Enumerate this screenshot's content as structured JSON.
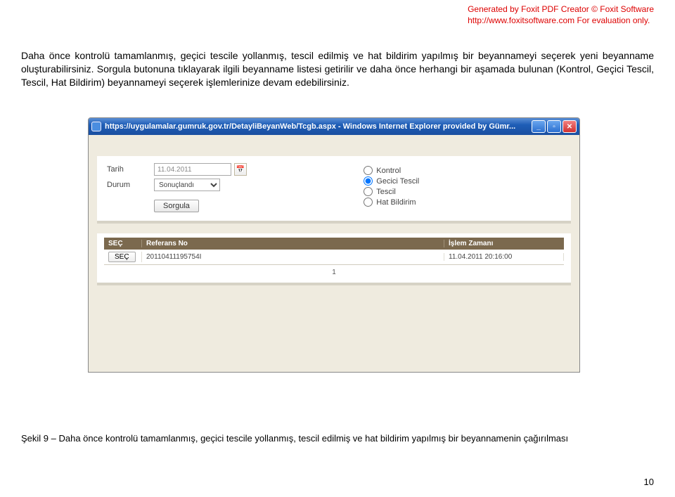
{
  "header": {
    "line1_prefix": "Generated by Foxit PDF Creator © Foxit Software",
    "line2_url": "http://www.foxitsoftware.com",
    "line2_eval": "   For evaluation only."
  },
  "paragraph": "Daha önce kontrolü tamamlanmış, geçici tescile yollanmış, tescil edilmiş ve hat bildirim yapılmış bir beyannameyi seçerek yeni beyanname oluşturabilirsiniz. Sorgula butonuna tıklayarak ilgili beyanname listesi getirilir ve daha önce herhangi bir aşamada bulunan (Kontrol, Geçici Tescil, Tescil, Hat Bildirim) beyannameyi seçerek işlemlerinize devam edebilirsiniz.",
  "window": {
    "title": "https://uygulamalar.gumruk.gov.tr/DetayliBeyanWeb/Tcgb.aspx - Windows Internet Explorer provided by Gümr..."
  },
  "form": {
    "tarih_label": "Tarih",
    "tarih_value": "11.04.2011",
    "durum_label": "Durum",
    "durum_value": "Sonuçlandı",
    "sorgula": "Sorgula",
    "radio_kontrol": "Kontrol",
    "radio_gecici": "Gecici Tescil",
    "radio_tescil": "Tescil",
    "radio_hat": "Hat Bildirim"
  },
  "grid": {
    "hdr_sec": "SEÇ",
    "hdr_ref": "Referans No",
    "hdr_time": "İşlem Zamanı",
    "row_sec_btn": "SEÇ",
    "row_ref": "20110411195754I",
    "row_time": "11.04.2011 20:16:00",
    "pager": "1"
  },
  "caption": "Şekil 9 – Daha önce kontrolü tamamlanmış, geçici tescile yollanmış, tescil edilmiş ve hat bildirim yapılmış bir beyannamenin çağırılması",
  "page_num": "10"
}
